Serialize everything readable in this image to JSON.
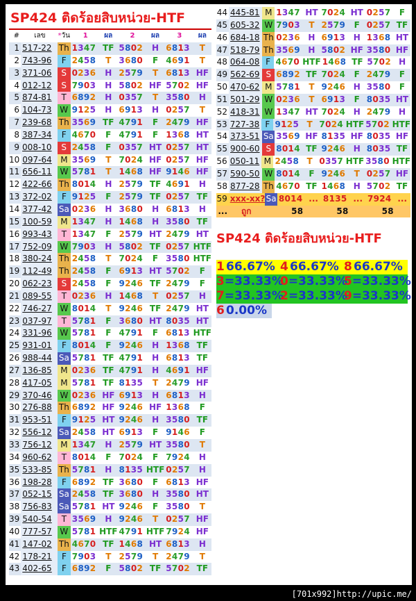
{
  "title": "SP424 ติดร้อยสิบหน่วย-HTF",
  "headers": {
    "no": "#",
    "code": "เลข",
    "star": "*",
    "day": "วัน",
    "n1": "1",
    "n2": "2",
    "n3": "3",
    "res": "ผล"
  },
  "rows": [
    [
      "1",
      "517-22",
      "Th",
      "1347",
      "TF",
      "5802",
      "H",
      "6813",
      "T"
    ],
    [
      "2",
      "743-96",
      "F",
      "2458",
      "T",
      "3680",
      "F",
      "4691",
      "T"
    ],
    [
      "3",
      "371-06",
      "S",
      "0236",
      "H",
      "2579",
      "T",
      "6813",
      "HF"
    ],
    [
      "4",
      "012-12",
      "S",
      "7903",
      "H",
      "5802",
      "HF",
      "5702",
      "HF"
    ],
    [
      "5",
      "874-81",
      "T",
      "6892",
      "H",
      "0357",
      "T",
      "3580",
      "H"
    ],
    [
      "6",
      "104-73",
      "W",
      "9125",
      "H",
      "6913",
      "H",
      "0257",
      "T"
    ],
    [
      "7",
      "239-68",
      "Th",
      "3569",
      "TF",
      "4791",
      "F",
      "2479",
      "HF"
    ],
    [
      "8",
      "387-34",
      "F",
      "4670",
      "F",
      "4791",
      "F",
      "1368",
      "HT"
    ],
    [
      "9",
      "008-10",
      "S",
      "2458",
      "F",
      "0357",
      "HT",
      "0257",
      "HT"
    ],
    [
      "10",
      "097-64",
      "M",
      "3569",
      "T",
      "7024",
      "HF",
      "0257",
      "HF"
    ],
    [
      "11",
      "656-11",
      "W",
      "5781",
      "T",
      "1468",
      "HF",
      "9146",
      "HF"
    ],
    [
      "12",
      "422-66",
      "Th",
      "8014",
      "H",
      "2579",
      "TF",
      "4691",
      "H"
    ],
    [
      "13",
      "372-02",
      "F",
      "9125",
      "F",
      "2579",
      "TF",
      "0257",
      "TF"
    ],
    [
      "14",
      "377-42",
      "Sa",
      "0236",
      "H",
      "3680",
      "H",
      "6813",
      "H"
    ],
    [
      "15",
      "100-59",
      "M",
      "1347",
      "H",
      "1468",
      "H",
      "3580",
      "TF"
    ],
    [
      "16",
      "993-43",
      "T",
      "1347",
      "F",
      "2579",
      "HT",
      "2479",
      "HT"
    ],
    [
      "17",
      "752-09",
      "W",
      "7903",
      "H",
      "5802",
      "TF",
      "0257",
      "HTF"
    ],
    [
      "18",
      "380-24",
      "Th",
      "2458",
      "T",
      "7024",
      "F",
      "3580",
      "HTF"
    ],
    [
      "19",
      "112-49",
      "Th",
      "2458",
      "F",
      "6913",
      "HT",
      "5702",
      "F"
    ],
    [
      "20",
      "062-23",
      "S",
      "2458",
      "F",
      "9246",
      "TF",
      "2479",
      "F"
    ],
    [
      "21",
      "089-55",
      "T",
      "0236",
      "H",
      "1468",
      "T",
      "0257",
      "H"
    ],
    [
      "22",
      "746-27",
      "W",
      "8014",
      "T",
      "9246",
      "TF",
      "2479",
      "HT"
    ],
    [
      "23",
      "037-97",
      "T",
      "5781",
      "F",
      "3680",
      "HT",
      "8035",
      "HT"
    ],
    [
      "24",
      "331-96",
      "W",
      "5781",
      "F",
      "4791",
      "F",
      "6813",
      "HTF"
    ],
    [
      "25",
      "931-01",
      "F",
      "8014",
      "F",
      "9246",
      "H",
      "1368",
      "TF"
    ],
    [
      "26",
      "988-44",
      "Sa",
      "5781",
      "TF",
      "4791",
      "H",
      "6813",
      "TF"
    ],
    [
      "27",
      "136-85",
      "M",
      "0236",
      "TF",
      "4791",
      "H",
      "4691",
      "HF"
    ],
    [
      "28",
      "417-05",
      "M",
      "5781",
      "TF",
      "8135",
      "T",
      "2479",
      "HF"
    ],
    [
      "29",
      "370-46",
      "W",
      "0236",
      "HF",
      "6913",
      "H",
      "6813",
      "H"
    ],
    [
      "30",
      "276-88",
      "Th",
      "6892",
      "HF",
      "9246",
      "HF",
      "1368",
      "F"
    ],
    [
      "31",
      "953-51",
      "F",
      "9125",
      "HT",
      "9246",
      "H",
      "3580",
      "TF"
    ],
    [
      "32",
      "556-12",
      "Sa",
      "2458",
      "HT",
      "6913",
      "F",
      "9146",
      "F"
    ],
    [
      "33",
      "756-12",
      "M",
      "1347",
      "H",
      "2579",
      "HT",
      "3580",
      "T"
    ],
    [
      "34",
      "960-62",
      "T",
      "8014",
      "F",
      "7024",
      "F",
      "7924",
      "H"
    ],
    [
      "35",
      "533-85",
      "Th",
      "5781",
      "H",
      "8135",
      "HTF",
      "0257",
      "H"
    ],
    [
      "36",
      "198-28",
      "F",
      "6892",
      "TF",
      "3680",
      "F",
      "6813",
      "HF"
    ],
    [
      "37",
      "052-15",
      "Sa",
      "2458",
      "TF",
      "3680",
      "H",
      "3580",
      "HT"
    ],
    [
      "38",
      "756-83",
      "Sa",
      "5781",
      "HT",
      "9246",
      "F",
      "3580",
      "T"
    ],
    [
      "39",
      "540-54",
      "T",
      "3569",
      "H",
      "9246",
      "T",
      "0257",
      "HF"
    ],
    [
      "40",
      "777-57",
      "W",
      "5781",
      "HTF",
      "4791",
      "HTF",
      "7924",
      "HF"
    ],
    [
      "41",
      "147-02",
      "Th",
      "4670",
      "TF",
      "1468",
      "HT",
      "6813",
      "H"
    ],
    [
      "42",
      "178-21",
      "F",
      "7903",
      "T",
      "2579",
      "T",
      "2479",
      "T"
    ],
    [
      "43",
      "402-65",
      "F",
      "6892",
      "F",
      "5802",
      "TF",
      "5702",
      "TF"
    ],
    [
      "44",
      "445-81",
      "M",
      "1347",
      "HT",
      "7024",
      "HT",
      "0257",
      "F"
    ],
    [
      "45",
      "605-32",
      "W",
      "7903",
      "T",
      "2579",
      "F",
      "0257",
      "TF"
    ],
    [
      "46",
      "684-18",
      "Th",
      "0236",
      "H",
      "6913",
      "H",
      "1368",
      "HT"
    ],
    [
      "47",
      "518-79",
      "Th",
      "3569",
      "H",
      "5802",
      "HF",
      "3580",
      "HF"
    ],
    [
      "48",
      "064-08",
      "F",
      "4670",
      "HTF",
      "1468",
      "TF",
      "5702",
      "H"
    ],
    [
      "49",
      "562-69",
      "S",
      "6892",
      "TF",
      "7024",
      "F",
      "2479",
      "F"
    ],
    [
      "50",
      "470-62",
      "M",
      "5781",
      "T",
      "9246",
      "H",
      "3580",
      "F"
    ],
    [
      "51",
      "501-29",
      "W",
      "0236",
      "T",
      "6913",
      "F",
      "8035",
      "HT"
    ],
    [
      "52",
      "418-31",
      "W",
      "1347",
      "HT",
      "7024",
      "H",
      "2479",
      "H"
    ],
    [
      "53",
      "727-38",
      "F",
      "9125",
      "T",
      "7024",
      "HTF",
      "5702",
      "HTF"
    ],
    [
      "54",
      "373-51",
      "Sa",
      "3569",
      "HF",
      "8135",
      "HF",
      "8035",
      "HF"
    ],
    [
      "55",
      "900-60",
      "S",
      "8014",
      "TF",
      "9246",
      "H",
      "8035",
      "TF"
    ],
    [
      "56",
      "050-11",
      "M",
      "2458",
      "T",
      "0357",
      "HTF",
      "3580",
      "HTF"
    ],
    [
      "57",
      "590-50",
      "W",
      "8014",
      "F",
      "9246",
      "T",
      "0257",
      "HF"
    ],
    [
      "58",
      "877-28",
      "Th",
      "4670",
      "TF",
      "1468",
      "H",
      "5702",
      "TF"
    ]
  ],
  "special_row": {
    "no": "59",
    "code": "xxx-xx",
    "mark": "?",
    "day": "Sa",
    "n1": "8014",
    "r1": "...",
    "n2": "8135",
    "r2": "...",
    "n3": "7924",
    "r3": "..."
  },
  "dots_row": {
    "no": "...",
    "code": "ถูก",
    "c1": "58",
    "c2": "58",
    "c3": "58"
  },
  "stats": [
    [
      {
        "k": "1",
        "v": " 66.67%"
      },
      {
        "k": "4",
        "v": " 66.67%"
      },
      {
        "k": "8",
        "v": " 66.67%"
      }
    ],
    [
      {
        "k": "3",
        "v": "=33.33%"
      },
      {
        "k": "0",
        "v": "=33.33%"
      },
      {
        "k": "5",
        "v": "=33.33%"
      }
    ],
    [
      {
        "k": "7",
        "v": "=33.33%"
      },
      {
        "k": "2",
        "v": "=33.33%"
      },
      {
        "k": "9",
        "v": "=33.33%"
      }
    ],
    [
      {
        "k": "6",
        "v": " 0.00%"
      }
    ]
  ],
  "footer": "[701x992]http://upic.me/"
}
